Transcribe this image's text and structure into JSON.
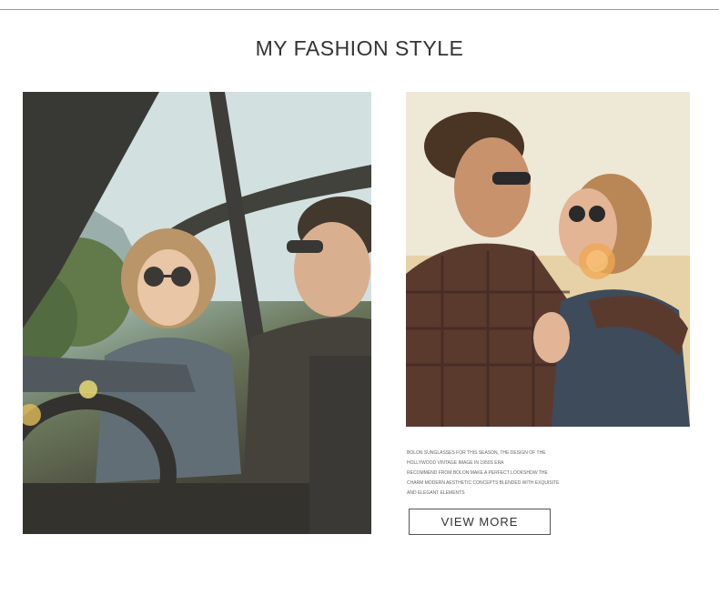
{
  "section": {
    "title": "MY FASHION STYLE"
  },
  "images": {
    "left_photo": "couple-in-convertible-photo",
    "right_photo": "couple-embracing-sunset-photo"
  },
  "description": {
    "lines": [
      "BOLON SUNGLASSES FOR THIS SEASON, THE DESIGN OF THE",
      "HOLLYWOOD VINTAGE IMAGE IN 1950S ERA",
      "RECOMMEND FROM BOLON MAKE A PERFECT LOOKSHOW THE",
      "CHARM MODERN AESTHETIC CONCEPTS BLENDED WITH EXQUISITE",
      "AND ELEGANT ELEMENTS"
    ]
  },
  "cta": {
    "label": "VIEW MORE"
  }
}
